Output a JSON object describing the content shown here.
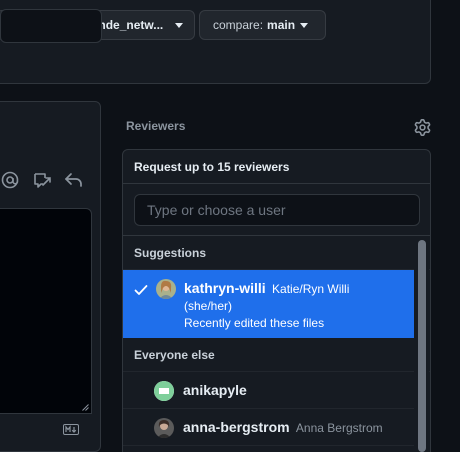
{
  "compare_bar": {
    "base_branch": "eeleb/poudre_sonde_netw...",
    "compare_prefix": "compare:",
    "compare_branch": "main"
  },
  "reviewers": {
    "label": "Reviewers",
    "dropdown": {
      "header": "Request up to 15 reviewers",
      "filter_placeholder": "Type or choose a user",
      "suggestions_header": "Suggestions",
      "everyone_header": "Everyone else",
      "suggestions": [
        {
          "login": "kathryn-willi",
          "name": "Katie/Ryn Willi",
          "pronouns": "(she/her)",
          "note": "Recently edited these files",
          "selected": true
        }
      ],
      "everyone": [
        {
          "login": "anikapyle",
          "name": ""
        },
        {
          "login": "anna-bergstrom",
          "name": "Anna Bergstrom"
        }
      ]
    }
  },
  "colors": {
    "background": "#0d1117",
    "panel": "#161b22",
    "border": "#30363d",
    "selected_row": "#1f6feb",
    "muted_text": "#8b949e"
  },
  "icons": [
    "mention-icon",
    "cross-reference-icon",
    "reply-icon",
    "gear-icon",
    "check-icon",
    "markdown-icon",
    "resize-handle-icon"
  ]
}
